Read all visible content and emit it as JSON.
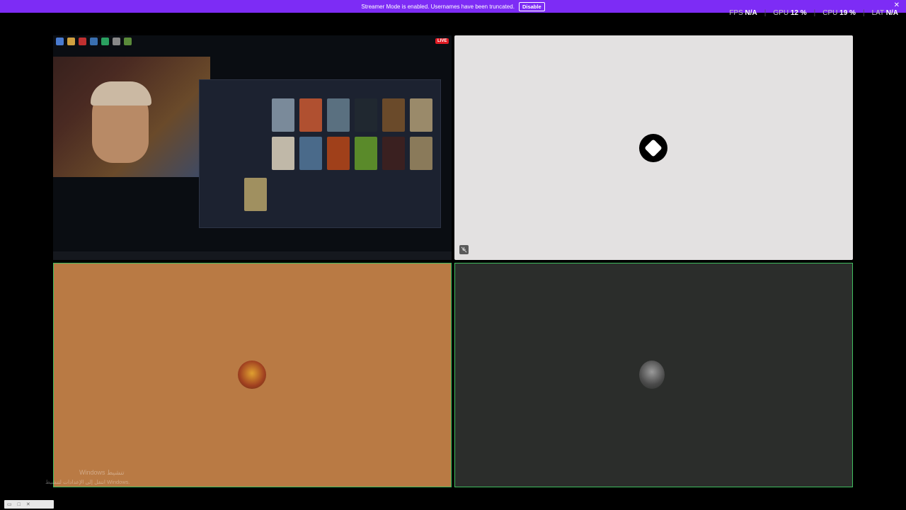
{
  "banner": {
    "message": "Streamer Mode is enabled. Usernames have been truncated.",
    "disable_label": "Disable",
    "close": "✕"
  },
  "stats": {
    "fps_label": "FPS",
    "fps_value": "N/A",
    "gpu_label": "GPU",
    "gpu_value": "12 %",
    "cpu_label": "CPU",
    "cpu_value": "19 %",
    "lat_label": "LAT",
    "lat_value": "N/A"
  },
  "stream": {
    "live_label": "LIVE"
  },
  "watermark": {
    "line1": "Windows تنشيط",
    "line2": "انتقل إلى الإعدادات لتنشيط Windows."
  },
  "colors": {
    "banner": "#7d2cf5",
    "speaking_border": "#3fbf5f",
    "tile_orange": "#b97a44",
    "tile_dark": "#2b2d2b",
    "tile_light": "#e3e1e1"
  },
  "icons": [
    "close-icon",
    "mic-muted-icon",
    "avatar-logo",
    "avatar-user"
  ]
}
